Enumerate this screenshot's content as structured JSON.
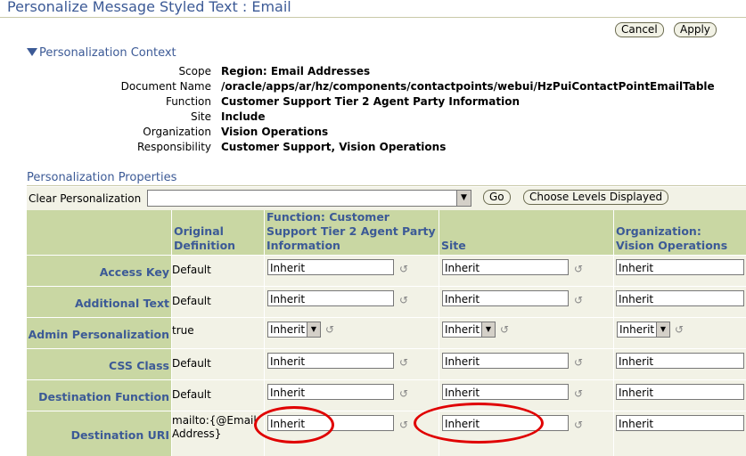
{
  "page": {
    "title": "Personalize Message Styled Text : Email"
  },
  "actions": {
    "cancel": "Cancel",
    "apply": "Apply"
  },
  "context": {
    "heading": "Personalization Context",
    "rows": [
      {
        "label": "Scope",
        "value": "Region: Email Addresses"
      },
      {
        "label": "Document Name",
        "value": "/oracle/apps/ar/hz/components/contactpoints/webui/HzPuiContactPointEmailTable"
      },
      {
        "label": "Function",
        "value": "Customer Support Tier 2 Agent Party Information"
      },
      {
        "label": "Site",
        "value": "Include"
      },
      {
        "label": "Organization",
        "value": "Vision Operations"
      },
      {
        "label": "Responsibility",
        "value": "Customer Support, Vision Operations"
      }
    ]
  },
  "properties": {
    "heading": "Personalization Properties",
    "clear_label": "Clear Personalization",
    "clear_value": "",
    "go": "Go",
    "choose_levels": "Choose Levels Displayed",
    "columns": {
      "original": "Original Definition",
      "function": "Function: Customer Support Tier 2 Agent Party Information",
      "site": "Site",
      "organization": "Organization: Vision Operations"
    },
    "rows": [
      {
        "name": "Access Key",
        "original": "Default",
        "function": "Inherit",
        "site": "Inherit",
        "organization": "Inherit",
        "kind": "text"
      },
      {
        "name": "Additional Text",
        "original": "Default",
        "function": "Inherit",
        "site": "Inherit",
        "organization": "Inherit",
        "kind": "text"
      },
      {
        "name": "Admin Personalization",
        "original": "true",
        "function": "Inherit",
        "site": "Inherit",
        "organization": "Inherit",
        "kind": "select"
      },
      {
        "name": "CSS Class",
        "original": "Default",
        "function": "Inherit",
        "site": "Inherit",
        "organization": "Inherit",
        "kind": "text"
      },
      {
        "name": "Destination Function",
        "original": "Default",
        "function": "Inherit",
        "site": "Inherit",
        "organization": "Inherit",
        "kind": "text"
      },
      {
        "name": "Destination URI",
        "original": "mailto:{@EmailAddress}",
        "function": "Inherit",
        "site": "Inherit",
        "organization": "Inherit",
        "kind": "text"
      }
    ]
  },
  "colors": {
    "accent": "#3c5a96",
    "header_bg": "#c9d7a3",
    "row_bg": "#f2f2e6",
    "annotation": "#e00000"
  },
  "icons": {
    "reset": "reset-arrow-icon",
    "disclosure": "triangle-down-icon",
    "dropdown": "chevron-down-icon"
  }
}
